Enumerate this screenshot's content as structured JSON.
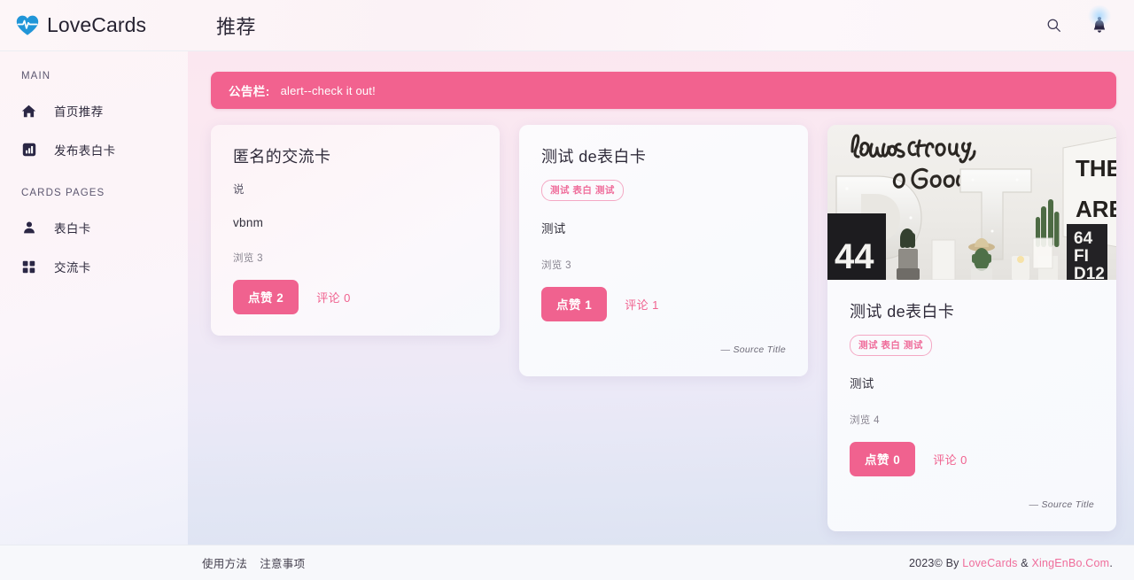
{
  "header": {
    "brand": "LoveCards",
    "brand_logo_icon": "heart-pulse-icon",
    "page_title": "推荐",
    "search_icon": "search-icon",
    "bell_icon": "bell-icon"
  },
  "sidebar": {
    "sections": [
      {
        "label": "MAIN",
        "items": [
          {
            "icon": "home-icon",
            "label": "首页推荐"
          },
          {
            "icon": "chart-square-icon",
            "label": "发布表白卡"
          }
        ]
      },
      {
        "label": "CARDS PAGES",
        "items": [
          {
            "icon": "person-icon",
            "label": "表白卡"
          },
          {
            "icon": "grid-icon",
            "label": "交流卡"
          }
        ]
      }
    ]
  },
  "main": {
    "announcement": {
      "label": "公告栏:",
      "text": "alert--check it out!"
    },
    "cards": [
      {
        "title": "匿名的交流卡",
        "subtitle": "说",
        "content": "vbnm",
        "views": "浏览 3",
        "like_label": "点赞 2",
        "comment_label": "评论 0"
      },
      {
        "title": "测试 de表白卡",
        "tag": "测试 表白 测试",
        "content": "测试",
        "views": "浏览 3",
        "like_label": "点赞 1",
        "comment_label": "评论 1",
        "source": "— Source Title"
      },
      {
        "title": "测试 de表白卡",
        "tag": "测试 表白 测试",
        "content": "测试",
        "views": "浏览 4",
        "like_label": "点赞 0",
        "comment_label": "评论 0",
        "source": "— Source Title",
        "photo_alt": "longs for you, O God — desk with letters D, T, cactus plants, 44 sign"
      }
    ]
  },
  "footer": {
    "links": [
      "使用方法",
      "注意事项"
    ],
    "copyright_prefix": "2023© By ",
    "link1": "LoveCards",
    "separator": " & ",
    "link2": "XingEnBo.Com",
    "copyright_suffix": "."
  },
  "colors": {
    "accent_pink": "#f0628f",
    "announce_pink": "#f2628f",
    "link_pink": "#ef6d9b",
    "logo_blue": "#2196d8",
    "sidebar_text": "#2e2a3d"
  }
}
